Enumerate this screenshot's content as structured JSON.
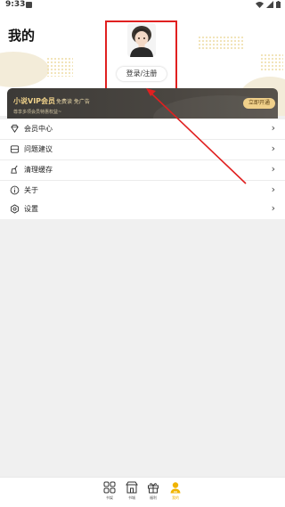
{
  "status_bar": {
    "time": "9:33"
  },
  "header": {
    "title": "我的",
    "login_label": "登录/注册"
  },
  "vip": {
    "title": "小说VIP会员",
    "subtitle": "免费读 免广告",
    "description": "尊享多项会员特惠权益~",
    "button": "立即开通"
  },
  "menu": {
    "items": [
      {
        "label": "会员中心",
        "icon": "diamond-icon"
      },
      {
        "label": "问题建议",
        "icon": "feedback-icon"
      },
      {
        "label": "清理缓存",
        "icon": "broom-icon"
      },
      {
        "label": "关于",
        "icon": "info-icon"
      }
    ],
    "settings": {
      "label": "设置",
      "icon": "gear-icon"
    }
  },
  "bottom_nav": {
    "items": [
      {
        "label": "书架",
        "icon": "grid-icon"
      },
      {
        "label": "书城",
        "icon": "store-icon"
      },
      {
        "label": "福利",
        "icon": "gift-icon"
      },
      {
        "label": "我的",
        "icon": "person-icon"
      }
    ],
    "active_index": 3
  },
  "colors": {
    "accent": "#f0b400",
    "annotation": "#e02020",
    "vip_gold": "#f0d28a"
  }
}
